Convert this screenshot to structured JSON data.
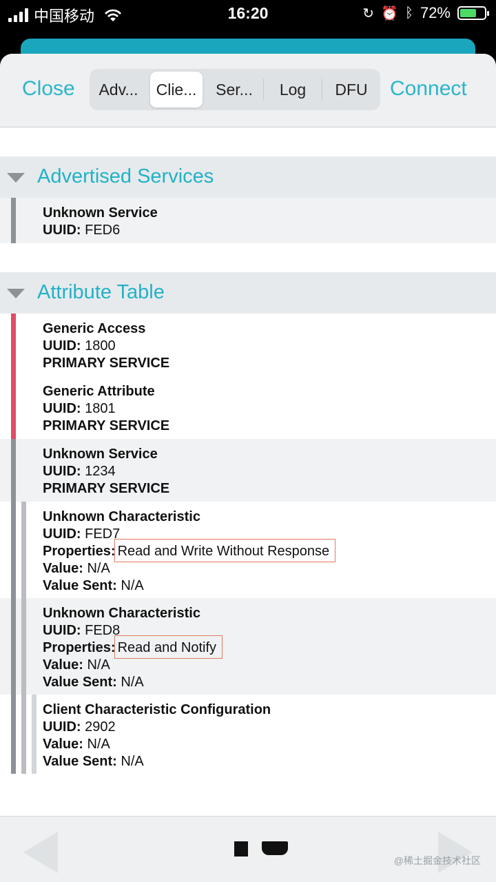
{
  "status": {
    "carrier": "中国移动",
    "time": "16:20",
    "battery_percent": "72%",
    "battery_level": 0.72,
    "colors": {
      "battery_fill": "#4cd964"
    }
  },
  "toolbar": {
    "close_label": "Close",
    "connect_label": "Connect",
    "tabs": [
      {
        "label": "Adv...",
        "active": false
      },
      {
        "label": "Clie...",
        "active": true
      },
      {
        "label": "Ser...",
        "active": false
      },
      {
        "label": "Log",
        "active": false
      },
      {
        "label": "DFU",
        "active": false
      }
    ],
    "accent_color": "#2bb5cc"
  },
  "advertised": {
    "title": "Advertised Services",
    "items": [
      {
        "name": "Unknown Service",
        "uuid_label": "UUID:",
        "uuid": "FED6"
      }
    ]
  },
  "attribute_table": {
    "title": "Attribute Table",
    "rows": [
      {
        "name": "Generic Access",
        "uuid_label": "UUID:",
        "uuid": "1800",
        "type": "PRIMARY SERVICE"
      },
      {
        "name": "Generic Attribute",
        "uuid_label": "UUID:",
        "uuid": "1801",
        "type": "PRIMARY SERVICE"
      },
      {
        "name": "Unknown Service",
        "uuid_label": "UUID:",
        "uuid": "1234",
        "type": "PRIMARY SERVICE"
      },
      {
        "name": "Unknown Characteristic",
        "uuid_label": "UUID:",
        "uuid": "FED7",
        "properties_label": "Properties:",
        "properties": "Read and Write Without Response",
        "value_label": "Value:",
        "value": "N/A",
        "value_sent_label": "Value Sent:",
        "value_sent": "N/A"
      },
      {
        "name": "Unknown Characteristic",
        "uuid_label": "UUID:",
        "uuid": "FED8",
        "properties_label": "Properties:",
        "properties": "Read and Notify",
        "value_label": "Value:",
        "value": "N/A",
        "value_sent_label": "Value Sent:",
        "value_sent": "N/A"
      },
      {
        "name": "Client Characteristic Configuration",
        "uuid_label": "UUID:",
        "uuid": "2902",
        "value_label": "Value:",
        "value": "N/A",
        "value_sent_label": "Value Sent:",
        "value_sent": "N/A"
      }
    ]
  },
  "colors": {
    "service_bar_red": "#e24a68",
    "service_bar_gray": "#8d9297",
    "char_bar_gray": "#b9bdc1",
    "highlight_box": "#e07a5f"
  },
  "watermark": "@稀土掘金技术社区"
}
